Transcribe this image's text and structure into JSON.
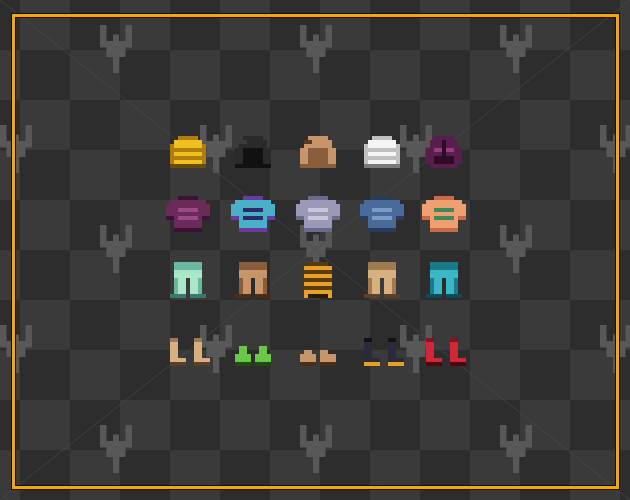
{
  "scene": {
    "type": "armor-sprite-sheet",
    "rows": 4,
    "columns": 5,
    "background": {
      "checker_dark": "#2d2d2d",
      "checker_light": "#3a3a3a",
      "watermark_color": "#5a5a5a"
    },
    "frame_color": "#e8a91c"
  },
  "items": [
    {
      "row": "helmets",
      "name": "gold-helmet-icon",
      "colors": [
        "#f0c020",
        "#b07d10",
        "#6a4a08"
      ]
    },
    {
      "row": "helmets",
      "name": "black-hood-icon",
      "colors": [
        "#2a2a2a",
        "#111111",
        "#3c3c3c"
      ]
    },
    {
      "row": "helmets",
      "name": "leather-hood-icon",
      "colors": [
        "#c8946a",
        "#8a5e3c",
        "#5a3a22"
      ]
    },
    {
      "row": "helmets",
      "name": "white-helmet-icon",
      "colors": [
        "#f4f4f4",
        "#c0c0c0",
        "#7a7a7a"
      ]
    },
    {
      "row": "helmets",
      "name": "purple-mask-helmet-icon",
      "colors": [
        "#5a1e4e",
        "#2e0c28",
        "#9a3a84"
      ]
    },
    {
      "row": "chest",
      "name": "purple-tunic-icon",
      "colors": [
        "#6a2a5a",
        "#3e1236",
        "#9a4a86"
      ]
    },
    {
      "row": "chest",
      "name": "blue-purple-robe-icon",
      "colors": [
        "#4ab0c8",
        "#6a3aa0",
        "#2e2a6a"
      ]
    },
    {
      "row": "chest",
      "name": "chainmail-shirt-icon",
      "colors": [
        "#9a9ab8",
        "#6a6a8a",
        "#c8c8dc"
      ]
    },
    {
      "row": "chest",
      "name": "steel-chestplate-icon",
      "colors": [
        "#4a6a9a",
        "#2a3a5a",
        "#7a9ac8"
      ]
    },
    {
      "row": "chest",
      "name": "orange-vest-icon",
      "colors": [
        "#f0a070",
        "#c86a4a",
        "#3a8a5a"
      ]
    },
    {
      "row": "legs",
      "name": "mint-pants-icon",
      "colors": [
        "#a8e8c8",
        "#6ab8a0",
        "#3a7a6a"
      ]
    },
    {
      "row": "legs",
      "name": "leather-pants-icon",
      "colors": [
        "#c8946a",
        "#8a5e3c",
        "#4a2e18"
      ]
    },
    {
      "row": "legs",
      "name": "woven-basket-icon",
      "colors": [
        "#e8a020",
        "#5a3a10",
        "#2a1a08"
      ]
    },
    {
      "row": "legs",
      "name": "tan-pants-icon",
      "colors": [
        "#d8b080",
        "#a07a50",
        "#5a4028"
      ]
    },
    {
      "row": "legs",
      "name": "teal-pants-icon",
      "colors": [
        "#3ab8c8",
        "#1a7a8a",
        "#0e4a5a"
      ]
    },
    {
      "row": "boots",
      "name": "tan-boots-icon",
      "colors": [
        "#d8b080",
        "#a07a50",
        "#5a4028"
      ]
    },
    {
      "row": "boots",
      "name": "green-shoes-icon",
      "colors": [
        "#6ac848",
        "#3a8a2a",
        "#1e4a14"
      ]
    },
    {
      "row": "boots",
      "name": "leather-slippers-icon",
      "colors": [
        "#c8946a",
        "#8a5e3c",
        "#4a2e18"
      ]
    },
    {
      "row": "boots",
      "name": "black-gold-boots-icon",
      "colors": [
        "#2a2a3a",
        "#111118",
        "#e8a020"
      ]
    },
    {
      "row": "boots",
      "name": "red-boots-icon",
      "colors": [
        "#d02838",
        "#8a1020",
        "#4a0810"
      ]
    }
  ]
}
